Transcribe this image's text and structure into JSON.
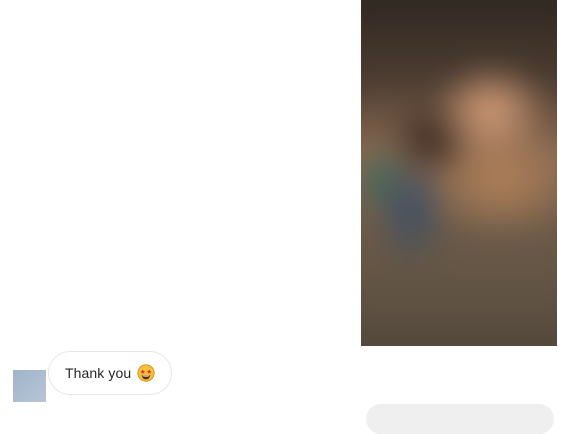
{
  "thread": {
    "outgoing_media": {
      "kind": "blurred-photo"
    },
    "incoming_message": {
      "text": "Thank you",
      "emoji": "star-struck-emoji"
    },
    "outgoing_partial": {
      "text": ""
    }
  },
  "colors": {
    "bubble_border": "#e4e6ea",
    "bubble_text": "#262626",
    "outgoing_bubble_bg": "#efefef"
  }
}
